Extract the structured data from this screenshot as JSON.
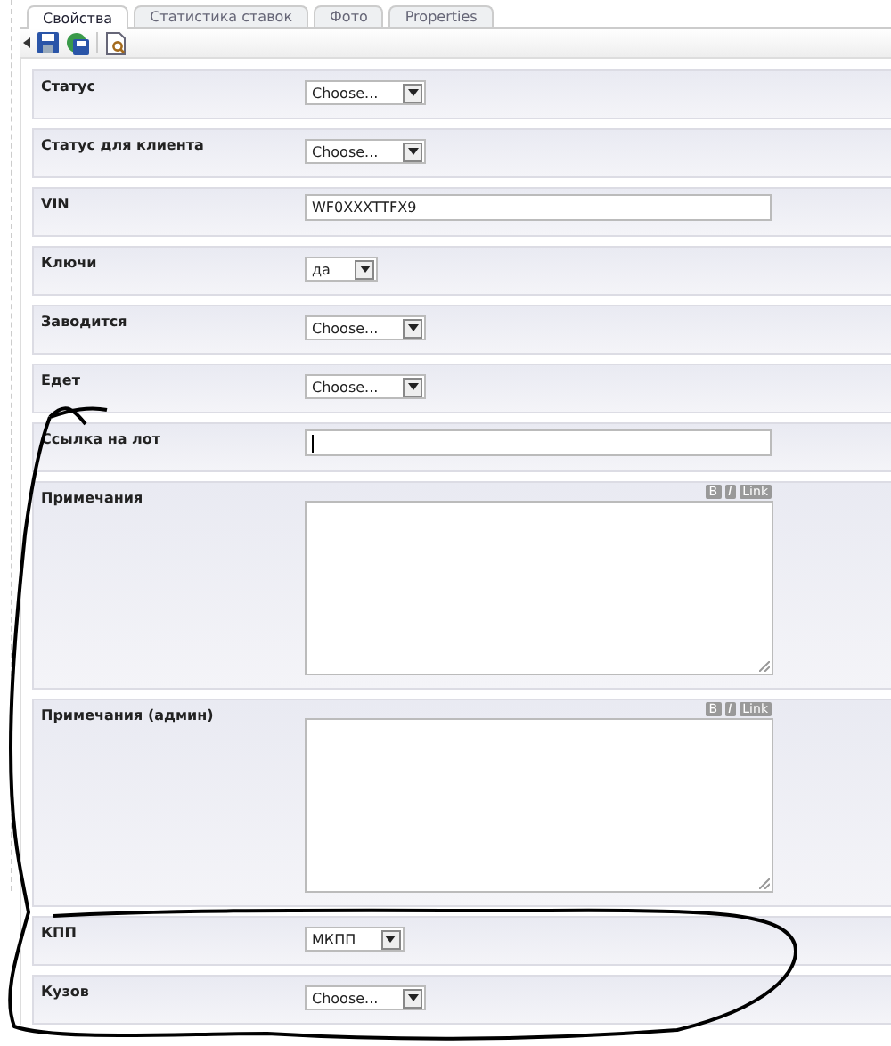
{
  "tabs": [
    {
      "label": "Свойства",
      "selected": true
    },
    {
      "label": "Статистика ставок",
      "selected": false
    },
    {
      "label": "Фото",
      "selected": false
    },
    {
      "label": "Properties",
      "selected": false
    }
  ],
  "fields": [
    {
      "kind": "select",
      "label": "Статус",
      "value": "Choose..."
    },
    {
      "kind": "select",
      "label": "Статус для клиента",
      "value": "Choose..."
    },
    {
      "kind": "text",
      "label": "VIN",
      "value": "WF0XXXTTFX9"
    },
    {
      "kind": "select",
      "label": "Ключи",
      "value": "да"
    },
    {
      "kind": "select",
      "label": "Заводится",
      "value": "Choose..."
    },
    {
      "kind": "select",
      "label": "Едет",
      "value": "Choose..."
    },
    {
      "kind": "text",
      "label": "Ссылка на лот"
    },
    {
      "kind": "textarea",
      "label": "Примечания",
      "format_buttons": [
        "B",
        "I",
        "Link"
      ]
    },
    {
      "kind": "textarea",
      "label": "Примечания (админ)",
      "format_buttons": [
        "B",
        "I",
        "Link"
      ]
    },
    {
      "kind": "select",
      "label": "КПП",
      "value": "МКПП"
    },
    {
      "kind": "select",
      "label": "Кузов",
      "value": "Choose..."
    }
  ]
}
